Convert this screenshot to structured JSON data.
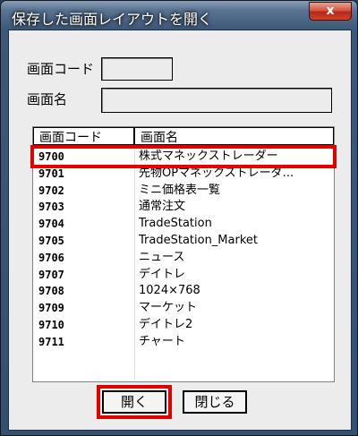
{
  "window": {
    "title": "保存した画面レイアウトを開く",
    "close_glyph": "x"
  },
  "form": {
    "code_label": "画面コード",
    "code_value": "",
    "name_label": "画面名",
    "name_value": ""
  },
  "list": {
    "columns": [
      "画面コード",
      "画面名"
    ],
    "rows": [
      {
        "code": "9700",
        "name": "株式マネックストレーダー"
      },
      {
        "code": "9701",
        "name": "先物OPマネックストレーダ..."
      },
      {
        "code": "9702",
        "name": "ミニ価格表一覧"
      },
      {
        "code": "9703",
        "name": "通常注文"
      },
      {
        "code": "9704",
        "name": "TradeStation"
      },
      {
        "code": "9705",
        "name": "TradeStation_Market"
      },
      {
        "code": "9706",
        "name": "ニュース"
      },
      {
        "code": "9707",
        "name": "デイトレ"
      },
      {
        "code": "9708",
        "name": "1024×768"
      },
      {
        "code": "9709",
        "name": "マーケット"
      },
      {
        "code": "9710",
        "name": "デイトレ2"
      },
      {
        "code": "9711",
        "name": "チャート"
      }
    ],
    "highlighted_row": 0
  },
  "buttons": {
    "open_label": "開く",
    "close_label": "閉じる"
  },
  "colors": {
    "highlight": "#e00000",
    "titlebar": "#3d5878"
  }
}
